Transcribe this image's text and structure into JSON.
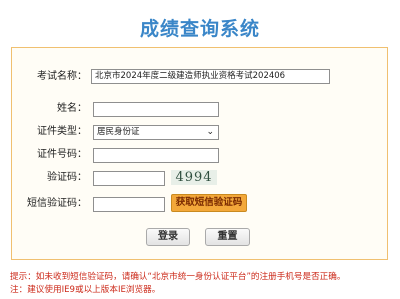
{
  "page_title": "成绩查询系统",
  "form": {
    "exam_name_label": "考试名称：",
    "exam_name_value": "北京市2024年度二级建造师执业资格考试202406",
    "name_label": "姓名：",
    "id_type_label": "证件类型：",
    "id_type_selected": "居民身份证",
    "id_number_label": "证件号码：",
    "captcha_label": "验证码：",
    "captcha_text": "4994",
    "sms_label": "短信验证码：",
    "sms_button": "获取短信验证码"
  },
  "buttons": {
    "login": "登录",
    "reset": "重置"
  },
  "notes": {
    "tip": "提示：如未收到短信验证码，请确认“北京市统一身份认证平台”的注册手机号是否正确。",
    "browser": "注：建议使用IE9或以上版本IE浏览器。"
  },
  "colors": {
    "title": "#3a86c8",
    "panel_border": "#f0c070",
    "sms_button": "#f3a83a",
    "notes": "#cc2a1a"
  }
}
